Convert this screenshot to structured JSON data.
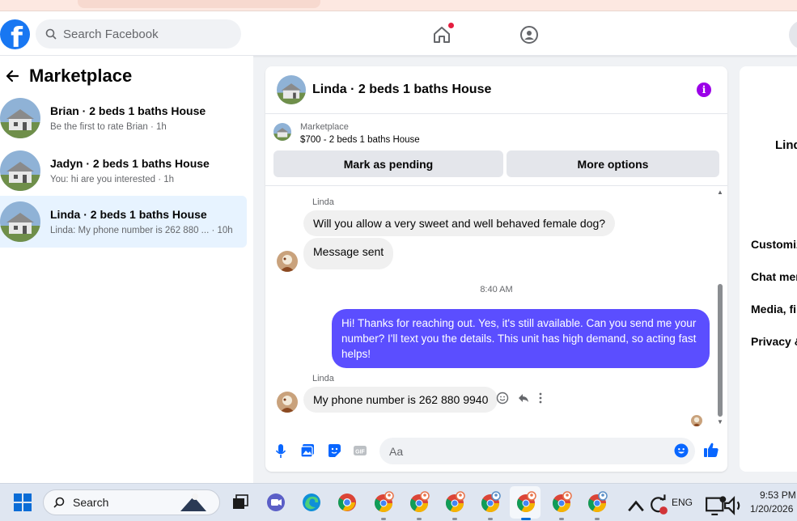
{
  "header": {
    "search_placeholder": "Search Facebook"
  },
  "sidebar": {
    "title": "Marketplace",
    "conversations": [
      {
        "name": "Brian · 2 beds 1 baths House",
        "preview": "Be the first to rate Brian · 1h",
        "selected": false
      },
      {
        "name": "Jadyn · 2 beds 1 baths House",
        "preview": "You: hi are you interested · 1h",
        "selected": false
      },
      {
        "name": "Linda · 2 beds 1 baths House",
        "preview": "Linda: My phone number is 262 880 ... · 10h",
        "selected": true
      }
    ]
  },
  "chat": {
    "title": "Linda · 2 beds 1 baths House",
    "listing": {
      "source": "Marketplace",
      "price_title": "$700 - 2 beds 1 baths House"
    },
    "buttons": {
      "pending": "Mark as pending",
      "more": "More options"
    },
    "messages": {
      "sender1": "Linda",
      "msg1": "Will you allow a very sweet and well behaved female dog?",
      "msg2": "Message sent",
      "time": "8:40 AM",
      "out": "Hi! Thanks for reaching out. Yes, it's still available. Can you send me your number? I'll text you the details. This unit has high demand, so acting fast helps!",
      "sender2": "Linda",
      "msg3": "My phone number is 262 880 9940"
    },
    "composer_placeholder": "Aa"
  },
  "right_panel": {
    "name_fragment": "Lind",
    "items": [
      "Customiz",
      "Chat mer",
      "Media, fil",
      "Privacy &"
    ]
  },
  "taskbar": {
    "search_label": "Search",
    "language": "ENG",
    "time": "9:53 PM",
    "date": "1/20/2026"
  },
  "colors": {
    "fb_blue": "#1877f2",
    "outgoing_bubble": "#5b4eff",
    "selected_row": "#e7f3ff",
    "info_icon": "#9b00e8"
  }
}
